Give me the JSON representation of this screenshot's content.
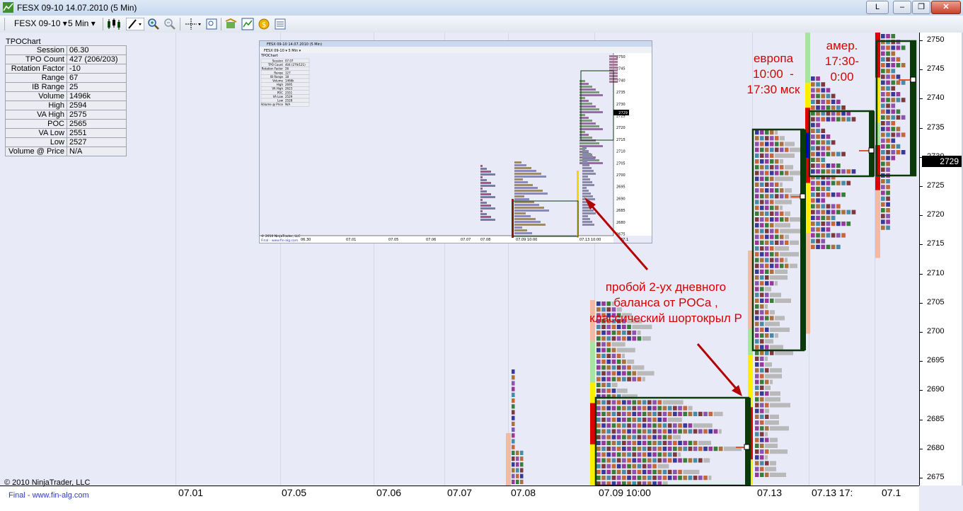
{
  "window": {
    "title": "FESX 09-10  14.07.2010 (5 Min)",
    "buttons": {
      "help": "L",
      "minimize": "–",
      "maximize": "❐",
      "close": "✕"
    }
  },
  "toolbar": {
    "instrument": "FESX 09-10",
    "interval": "5 Min",
    "dropdown_glyph": "▾"
  },
  "stats": {
    "title": "TPOChart",
    "rows": [
      {
        "label": "Session",
        "value": "06.30"
      },
      {
        "label": "TPO Count",
        "value": "427 (206/203)"
      },
      {
        "label": "Rotation Factor",
        "value": "-10"
      },
      {
        "label": "Range",
        "value": "67"
      },
      {
        "label": "IB Range",
        "value": "25"
      },
      {
        "label": "Volume",
        "value": "1496k"
      },
      {
        "label": "High",
        "value": "2594"
      },
      {
        "label": "VA High",
        "value": "2575"
      },
      {
        "label": "POC",
        "value": "2565"
      },
      {
        "label": "VA Low",
        "value": "2551"
      },
      {
        "label": "Low",
        "value": "2527"
      },
      {
        "label": "Volume @ Price",
        "value": "N/A"
      }
    ]
  },
  "inset": {
    "title": "FESX 09-10    14.07.2010 (5 Min)",
    "toolbar": "FESX 09-10 ▾  5 Min ▾",
    "stats_title": "TPOChart",
    "stats": [
      {
        "label": "Session",
        "value": "07.07"
      },
      {
        "label": "TPO Count",
        "value": "404 (279/121)"
      },
      {
        "label": "Rotation Factor",
        "value": "26"
      },
      {
        "label": "Range",
        "value": "127"
      },
      {
        "label": "IB Range",
        "value": "18"
      },
      {
        "label": "Volume",
        "value": "1466k"
      },
      {
        "label": "High",
        "value": "2695"
      },
      {
        "label": "VA High",
        "value": "2623"
      },
      {
        "label": "POC",
        "value": "2551"
      },
      {
        "label": "VA Low",
        "value": "2529"
      },
      {
        "label": "Low",
        "value": "2528"
      },
      {
        "label": "Volume @ Price",
        "value": "N/A"
      }
    ],
    "x_labels": [
      "06.30",
      "07.01",
      "07.05",
      "07.06",
      "07.07",
      "07.08",
      "07.09 10:00",
      "07.13 10:00",
      "07.1"
    ],
    "y_labels": [
      "2750",
      "2745",
      "2740",
      "2735",
      "2730",
      "2725",
      "2720",
      "2715",
      "2710",
      "2705",
      "2700",
      "2695",
      "2690",
      "2685",
      "2680",
      "2675"
    ],
    "price_tag": "2729",
    "copyright": "© 2010 NinjaTrader, LLC",
    "footer": "Final - www.fin-alg.com"
  },
  "y_axis": {
    "labels": [
      "2750",
      "2745",
      "2740",
      "2735",
      "2730",
      "2725",
      "2720",
      "2715",
      "2710",
      "2705",
      "2700",
      "2695",
      "2690",
      "2685",
      "2680",
      "2675"
    ],
    "current_price": "2729"
  },
  "x_axis": {
    "labels": [
      "07.01",
      "07.05",
      "07.06",
      "07.07",
      "07.08",
      "07.09 10:00",
      "07.13",
      "07.13 17:",
      "07.1"
    ]
  },
  "annotations": {
    "europe": "европа\n10:00  -\n17:30 мск",
    "america": "амер.\n17:30-\n0:00",
    "breakout": "пробой 2-ух дневного\nбаланса от POCа ,\nклассический шортокрыл Р"
  },
  "footer": {
    "copyright": "© 2010 NinjaTrader, LLC",
    "link": "Final - www.fin-alg.com"
  },
  "colors": {
    "background": "#e9eaf8",
    "value_area_box": "#0a3a0a",
    "annotation": "#d60000",
    "price_tag": "#000000"
  }
}
